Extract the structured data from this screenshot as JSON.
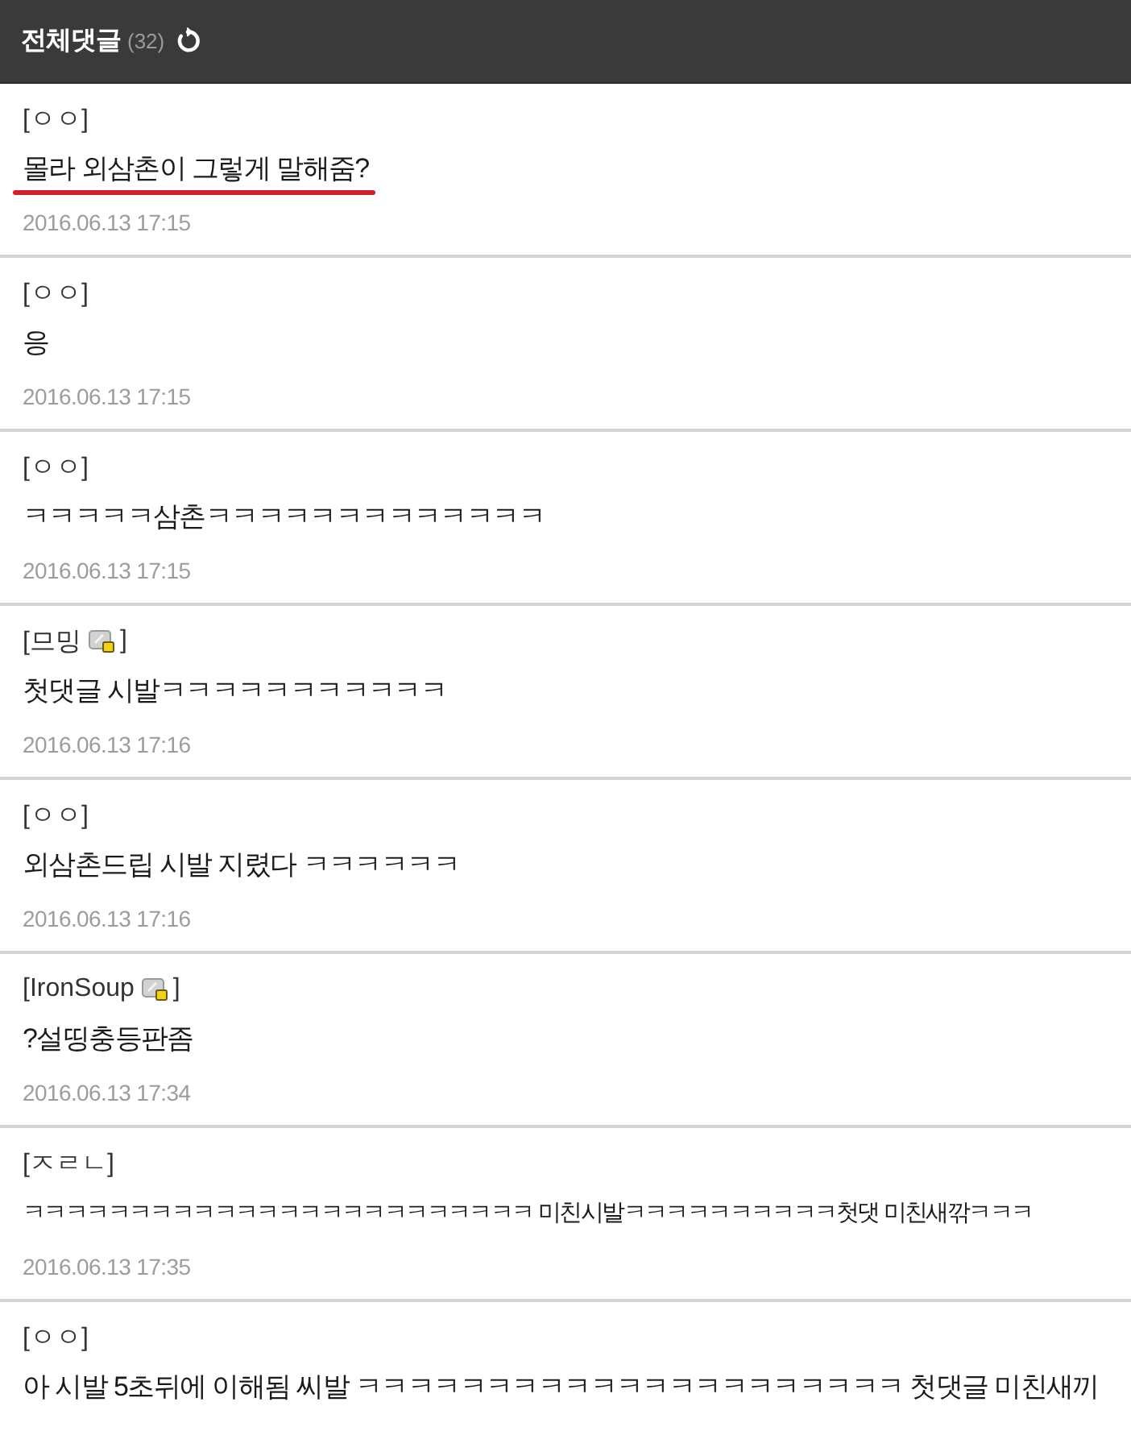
{
  "header": {
    "title": "전체댓글",
    "count": "(32)"
  },
  "comments": [
    {
      "author": {
        "open": "[",
        "name": "ㅇㅇ",
        "close": "]"
      },
      "member_icon": false,
      "text": "몰라 외삼촌이 그렇게 말해줌?",
      "underlined": true,
      "date": "2016.06.13 17:15"
    },
    {
      "author": {
        "open": "[",
        "name": "ㅇㅇ",
        "close": "]"
      },
      "member_icon": false,
      "text": "응",
      "underlined": false,
      "date": "2016.06.13 17:15"
    },
    {
      "author": {
        "open": "[",
        "name": "ㅇㅇ",
        "close": "]"
      },
      "member_icon": false,
      "text": "ㅋㅋㅋㅋㅋ삼촌ㅋㅋㅋㅋㅋㅋㅋㅋㅋㅋㅋㅋㅋ",
      "underlined": false,
      "date": "2016.06.13 17:15"
    },
    {
      "author": {
        "open": "[",
        "name": "므밍",
        "close": "]"
      },
      "member_icon": true,
      "text": "첫댓글 시발ㅋㅋㅋㅋㅋㅋㅋㅋㅋㅋㅋ",
      "underlined": false,
      "date": "2016.06.13 17:16"
    },
    {
      "author": {
        "open": "[",
        "name": "ㅇㅇ",
        "close": "]"
      },
      "member_icon": false,
      "text": "외삼촌드립 시발 지렸다 ㅋㅋㅋㅋㅋㅋ",
      "underlined": false,
      "date": "2016.06.13 17:16"
    },
    {
      "author": {
        "open": "[",
        "name": "IronSoup",
        "close": "]"
      },
      "member_icon": true,
      "text": "?설띵충등판좀",
      "underlined": false,
      "date": "2016.06.13 17:34"
    },
    {
      "author": {
        "open": "[",
        "name": "ㅈㄹㄴ",
        "close": "]"
      },
      "member_icon": false,
      "text": "ㅋㅋㅋㅋㅋㅋㅋㅋㅋㅋㅋㅋㅋㅋㅋㅋㅋㅋㅋㅋㅋㅋㅋㅋ 미친시발ㅋㅋㅋㅋㅋㅋㅋㅋㅋㅋ첫댓 미친새깎ㅋㅋㅋ",
      "underlined": false,
      "date": "2016.06.13 17:35"
    },
    {
      "author": {
        "open": "[",
        "name": "ㅇㅇ",
        "close": "]"
      },
      "member_icon": false,
      "text": "아 시발 5초뒤에 이해됨 씨발 ㅋㅋㅋㅋㅋㅋㅋㅋㅋㅋㅋㅋㅋㅋㅋㅋㅋㅋㅋㅋㅋ 첫댓글 미친새끼",
      "underlined": false
    }
  ]
}
